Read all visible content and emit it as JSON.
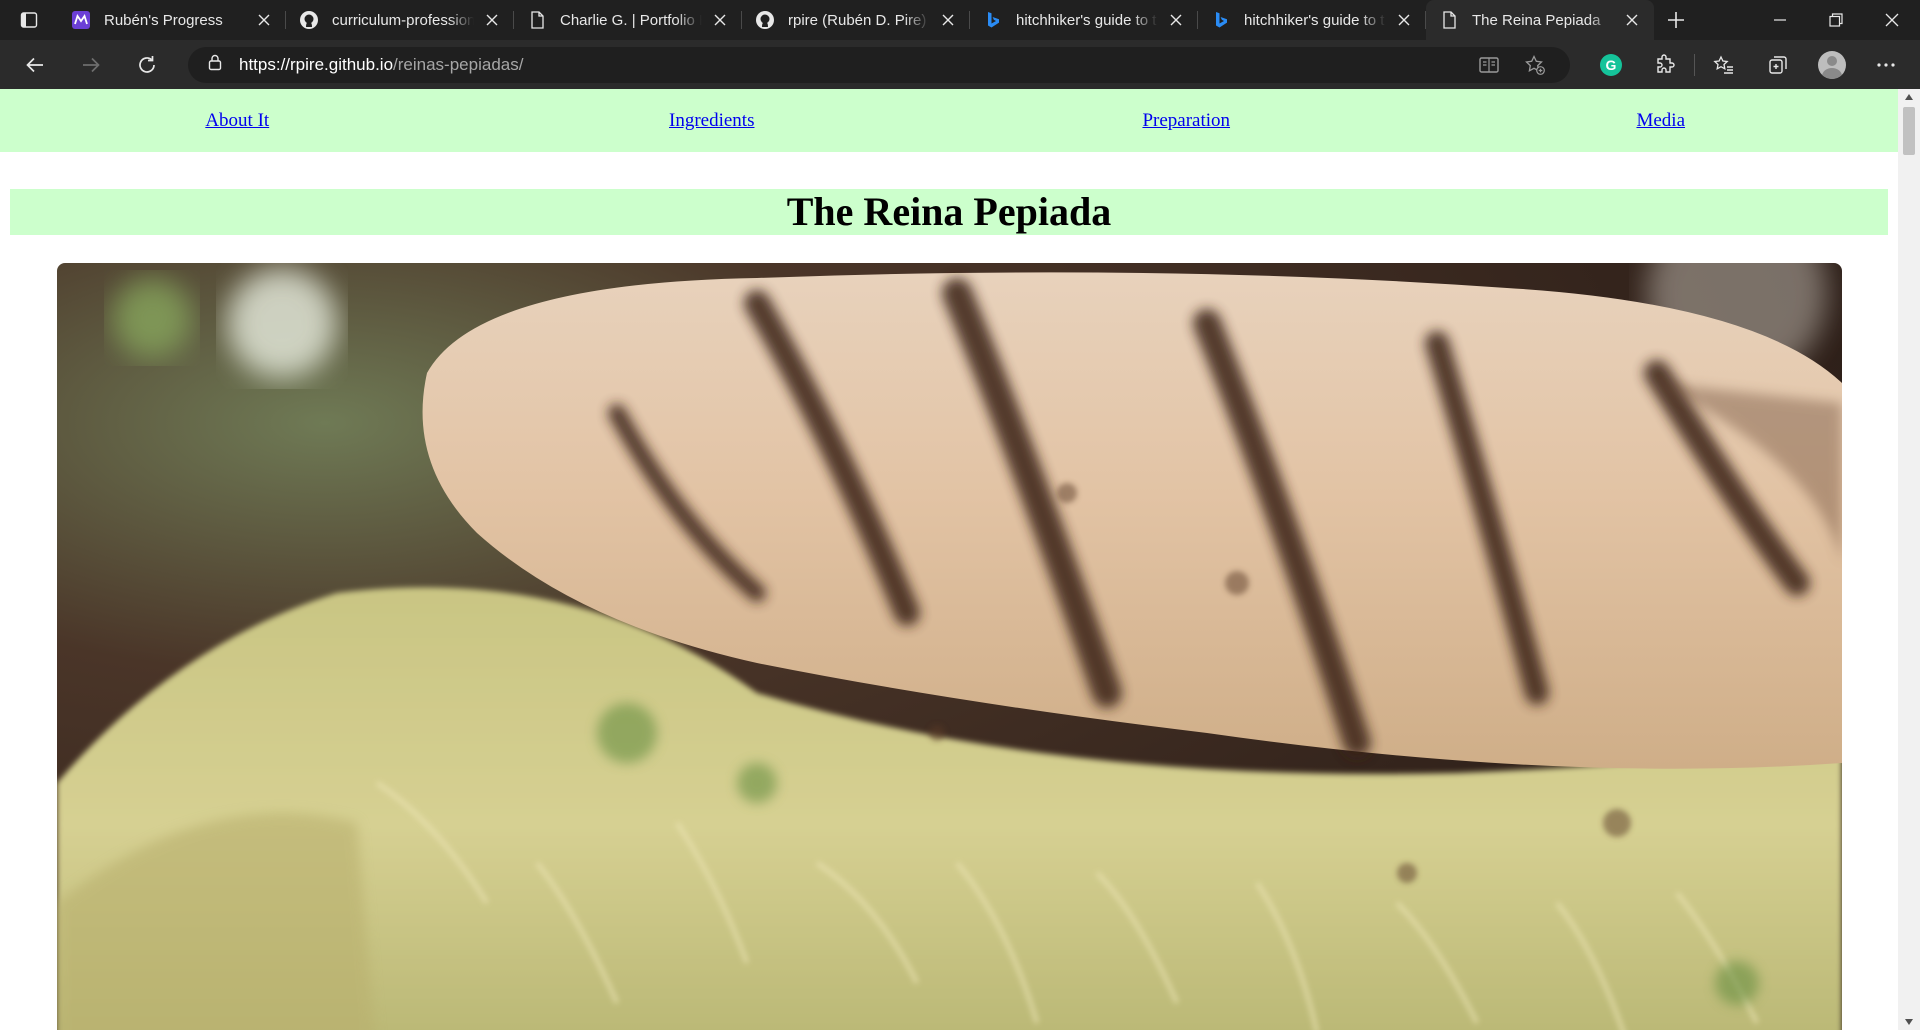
{
  "browser": {
    "tabs": [
      {
        "title": "Rubén's Progress",
        "icon": "purple-m-icon",
        "active": false
      },
      {
        "title": "curriculum-professional",
        "icon": "github-icon",
        "active": false
      },
      {
        "title": "Charlie G. | Portfolio Hub",
        "icon": "page-icon",
        "active": false
      },
      {
        "title": "rpire (Rubén D. Pire)",
        "icon": "github-icon",
        "active": false
      },
      {
        "title": "hitchhiker's guide to the",
        "icon": "bing-icon",
        "active": false
      },
      {
        "title": "hitchhiker's guide to the",
        "icon": "bing-icon",
        "active": false
      },
      {
        "title": "The Reina Pepiada",
        "icon": "page-icon",
        "active": true
      }
    ],
    "address": {
      "host": "https://rpire.github.io",
      "path": "/reinas-pepiadas/"
    }
  },
  "page": {
    "nav": [
      {
        "label": "About It"
      },
      {
        "label": "Ingredients"
      },
      {
        "label": "Preparation"
      },
      {
        "label": "Media"
      }
    ],
    "title": "The Reina Pepiada",
    "hero_image": "reina-pepiada-arepa-photo"
  }
}
